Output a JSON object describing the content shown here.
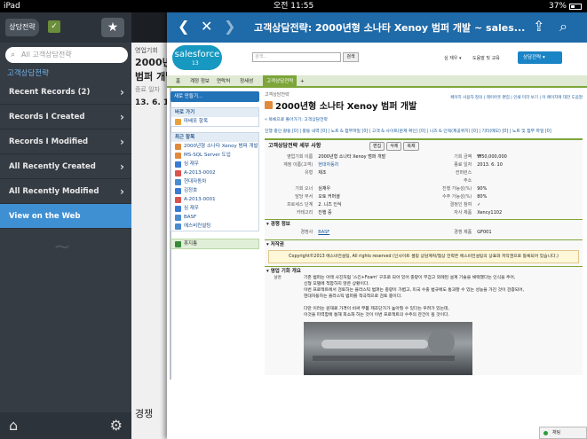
{
  "status": {
    "device": "iPad",
    "time": "오전 11:55",
    "battery": "37%"
  },
  "sidebar": {
    "back_label": "상담전략",
    "search_placeholder": "All 고객상담전략",
    "section_title": "고객상담전략",
    "items": [
      {
        "label": "Recent Records (2)",
        "selected": false
      },
      {
        "label": "Records I Created",
        "selected": false
      },
      {
        "label": "Records I Modified",
        "selected": false
      },
      {
        "label": "All Recently Created",
        "selected": false
      },
      {
        "label": "All Recently Modified",
        "selected": false
      },
      {
        "label": "View on the Web",
        "selected": true
      }
    ],
    "icons": {
      "home": "home-icon",
      "settings": "gear-icon",
      "star": "star-icon"
    }
  },
  "middle": {
    "line1": "영업기회",
    "line2": "2000년형",
    "line3": "범퍼 개발",
    "line4": "종료 일자",
    "line5": "13. 6. 10",
    "line6": "경쟁"
  },
  "panel": {
    "title": "고객상담전략: 2000년형 소나타 Xenoy 범퍼 개발 ~ sales...",
    "icons": [
      "back-arrow-icon",
      "close-icon",
      "forward-arrow-icon",
      "share-icon",
      "search-icon"
    ]
  },
  "web": {
    "logo_text": "salesforce",
    "logo_version": "13",
    "search_placeholder": "검색...",
    "search_button": "검색",
    "user_label": "심 재우 ▾",
    "help_label": "도움말 및 교육",
    "app_button": "상담전략 ▾",
    "tabs": [
      "홈",
      "계정 정보",
      "연락처",
      "정세성",
      "고객상담전략",
      "+"
    ],
    "active_tab": "고객상담전략",
    "new_button": "새로 만들기...",
    "recent_items_title": "최근 항목",
    "quick_title": "바로 가기",
    "quick_item": "마배포 항목",
    "recent_items": [
      {
        "label": "2000년형 소나타 Xenoy 범퍼 개발",
        "color": "#e08a3c"
      },
      {
        "label": "MS-SQL Server 도입",
        "color": "#e08a3c"
      },
      {
        "label": "심 재우",
        "color": "#3a7bd5"
      },
      {
        "label": "A-2013-0002",
        "color": "#d9534f"
      },
      {
        "label": "현대자동차",
        "color": "#4b8bd0"
      },
      {
        "label": "김정호",
        "color": "#3a7bd5"
      },
      {
        "label": "A-2013-0001",
        "color": "#d9534f"
      },
      {
        "label": "심 재우",
        "color": "#3a7bd5"
      },
      {
        "label": "BASF",
        "color": "#4b8bd0"
      },
      {
        "label": "에스비컨설팅",
        "color": "#4b8bd0"
      }
    ],
    "recycle_bin": "휴지통",
    "breadcrumb": "고객상담전략",
    "record_title": "2000년형 소나타 Xenoy 범퍼 개발",
    "page_links": "페이지 사용자 정의 | 레이아웃 편집 | 인쇄 미리 보기 | 이 페이지에 대한 도움말",
    "back_link": "« 목록으로 돌아가기: 고객상담전략",
    "quick_links": "진행 중인 활동 [0] | 활동 내역 [0] | 노트 & 첨부파일 [0] | 고객 & 사이트(문제 확인) [0] | 니즈 & 인덱(제공위치) [0] | 기타(메모) [0] | 노트 및 첨부 파일 [0]",
    "detail_header": "고객상담전략 세부 사항",
    "detail_buttons": [
      "편집",
      "삭제",
      "복제"
    ],
    "fields_left": [
      {
        "k": "영업기회 이름",
        "v": "2000년형 소나타 Xenoy 범퍼 개발"
      },
      {
        "k": "계정 이름(고객)",
        "v": "현대자동차"
      },
      {
        "k": "유형",
        "v": "제조"
      },
      {
        "k": "",
        "v": ""
      },
      {
        "k": "기회 오너",
        "v": "심재우"
      },
      {
        "k": "담당 부서",
        "v": "오토 커머셜"
      },
      {
        "k": "프로세스 단계",
        "v": "2. 니즈 인식"
      },
      {
        "k": "카테고리",
        "v": "진행 중"
      },
      {
        "k": "",
        "v": ""
      }
    ],
    "fields_right": [
      {
        "k": "기회 금액",
        "v": "₩50,000,000"
      },
      {
        "k": "종료 일자",
        "v": "2013. 6. 10"
      },
      {
        "k": "컨퍼런스",
        "v": ""
      },
      {
        "k": "주소",
        "v": ""
      },
      {
        "k": "진행 가능성(%)",
        "v": "90%"
      },
      {
        "k": "수주 가능성(%)",
        "v": "80%"
      },
      {
        "k": "결정인 참여",
        "v": "✓"
      },
      {
        "k": "자사 제품",
        "v": "Xency1102"
      }
    ],
    "section_competition": "경쟁 정보",
    "competitor_label": "경쟁사",
    "competitor_value": "BASF",
    "competitor_product_label": "경쟁 제품",
    "competitor_product_value": "GF001",
    "section_copyright": "저작권",
    "copyright_text": "Copyright©2013 에스비컨설팅, All rights reserved (인사이트 셀링 상담계획/협상 전략은 에스비컨설팅의 상표와 저작권으로 등록되어 있습니다.)",
    "section_overview": "영업 기회 개요",
    "desc_label": "설명",
    "desc_lines": [
      "기존 범퍼는 아래 사진처럼 '스킨+Foam' 구조로 되어 있어 충량이 무겁고 외례된 설계 기술을 채택했다는 인식을 주어,",
      "신형 모델에 적합하지 않은 상황이다.",
      "이번 프로젝트에서 검토하는 플라스틱 범퍼는 충량이 가볍고, 미국 수출 법규에도 통과할 수 있는 성능을 가진 것이 검증되어,",
      "현대자동차는 플라스틱 범퍼를 적극적으로 검토 중이다.",
      "",
      "다만 이러는 원재료 가격이 비싸 부품 제조단가가 높아질 수 있다는 우려가 있는데,",
      "이것을 피력함에 통해 회소화 하는 것이 이번 프로젝트의 수주의 관건이 될 것이다."
    ],
    "chat_label": "채팅"
  }
}
